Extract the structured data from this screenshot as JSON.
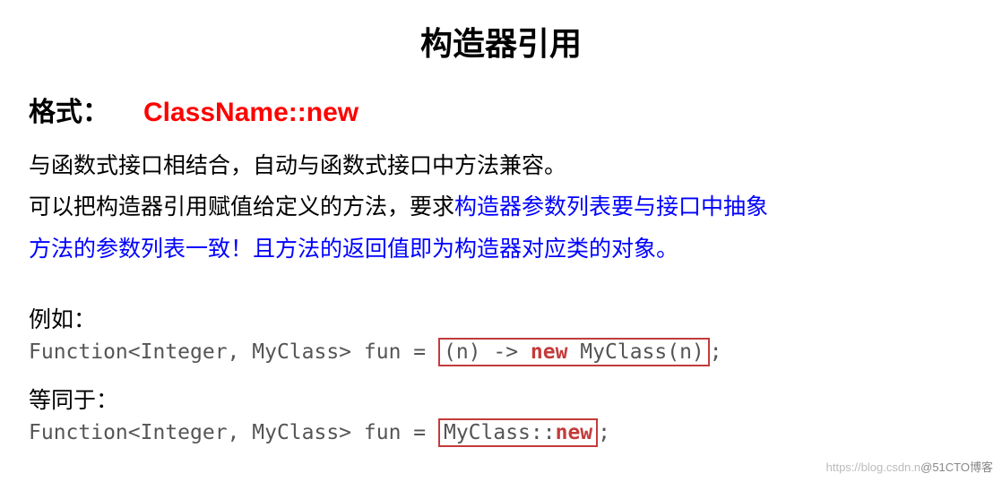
{
  "title": "构造器引用",
  "format": {
    "label": "格式：",
    "value": "ClassName::new"
  },
  "body": {
    "line1": "与函数式接口相结合，自动与函数式接口中方法兼容。",
    "line2_black": "可以把构造器引用赋值给定义的方法，要求",
    "line2_blue": "构造器参数列表要与接口中抽象",
    "line3_blue": "方法的参数列表一致！且方法的返回值即为构造器对应类的对象。"
  },
  "example1": {
    "label": "例如：",
    "code_prefix": "Function<Integer, MyClass> fun = ",
    "boxed_part1": "(n) -> ",
    "boxed_new": "new",
    "boxed_part2": " MyClass(n)",
    "code_suffix": ";"
  },
  "example2": {
    "label": "等同于：",
    "code_prefix": "Function<Integer, MyClass> fun = ",
    "boxed_part1": "MyClass::",
    "boxed_new": "new",
    "code_suffix": ";"
  },
  "watermark": {
    "light": "https://blog.csdn.n",
    "dark": "@51CTO博客"
  }
}
